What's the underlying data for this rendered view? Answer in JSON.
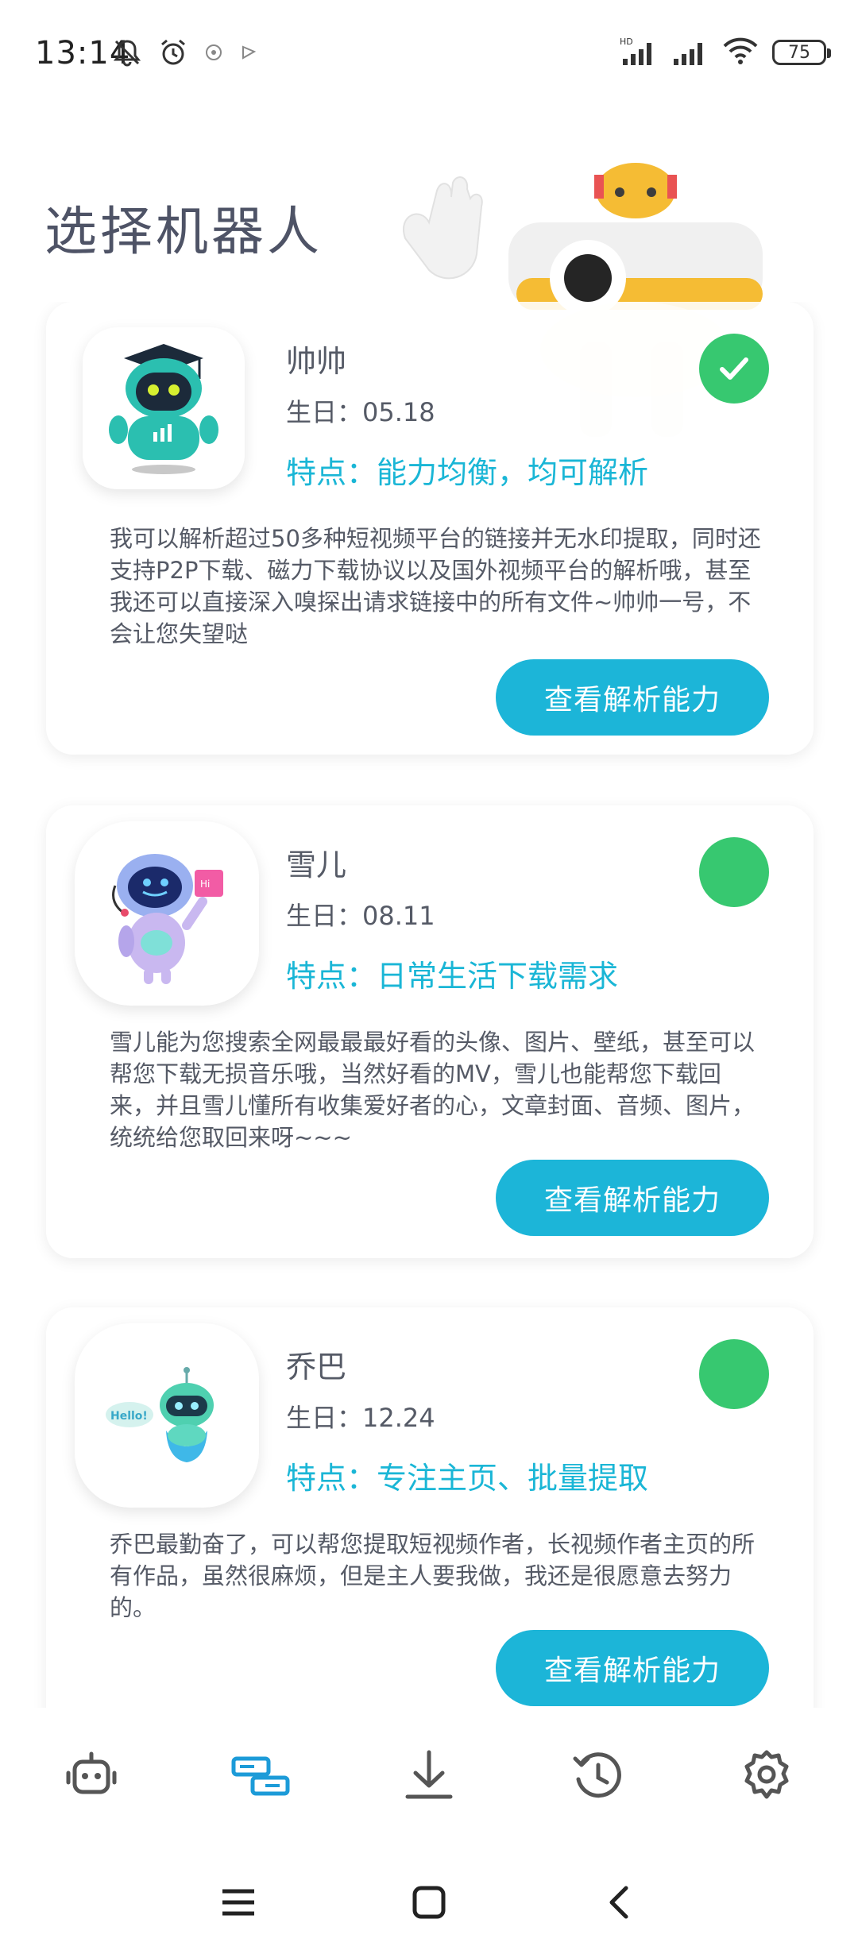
{
  "status_bar": {
    "time": "13:14",
    "battery": "75",
    "icons": [
      "mute-icon",
      "alarm-icon",
      "notification-icon",
      "notification-icon-2",
      "hd-signal-icon",
      "signal-icon",
      "wifi-icon",
      "battery-icon"
    ]
  },
  "header": {
    "title": "选择机器人"
  },
  "robots": [
    {
      "name": "帅帅",
      "birthday": "生日：05.18",
      "feature": "特点：能力均衡，均可解析",
      "description": "我可以解析超过50多种短视频平台的链接并无水印提取，同时还支持P2P下载、磁力下载协议以及国外视频平台的解析哦，甚至我还可以直接深入嗅探出请求链接中的所有文件~帅帅一号，不会让您失望哒",
      "selected": true,
      "button": "查看解析能力"
    },
    {
      "name": "雪儿",
      "birthday": "生日：08.11",
      "feature": "特点：日常生活下载需求",
      "description": "雪儿能为您搜索全网最最最好看的头像、图片、壁纸，甚至可以帮您下载无损音乐哦，当然好看的MV，雪儿也能帮您下载回来，并且雪儿懂所有收集爱好者的心，文章封面、音频、图片，统统给您取回来呀~~~",
      "selected": false,
      "button": "查看解析能力"
    },
    {
      "name": "乔巴",
      "birthday": "生日：12.24",
      "feature": "特点：专注主页、批量提取",
      "description": "乔巴最勤奋了，可以帮您提取短视频作者，长视频作者主页的所有作品，虽然很麻烦，但是主人要我做，我还是很愿意去努力的。",
      "selected": false,
      "button": "查看解析能力"
    }
  ],
  "bottom_nav": [
    "robot-icon",
    "parse-icon",
    "download-icon",
    "history-icon",
    "settings-icon"
  ],
  "colors": {
    "accent": "#1cb5d8",
    "selected_green": "#37c870",
    "active_nav": "#1c9bd8"
  }
}
